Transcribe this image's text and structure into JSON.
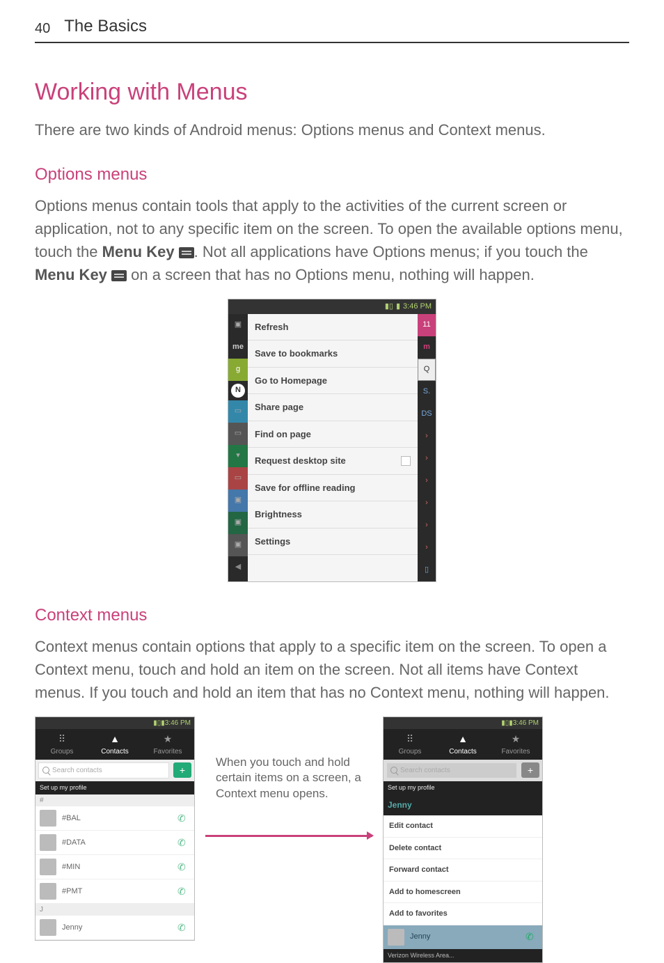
{
  "page": {
    "number": "40",
    "breadcrumb": "The Basics"
  },
  "h1": "Working with Menus",
  "intro": "There are two kinds of Android menus: Options menus and Context menus.",
  "options": {
    "heading": "Options menus",
    "p_a": "Options menus contain tools that apply to the activities of the current screen or application, not to any specific item on the screen. To open the available options menu, touch the ",
    "menu_key_1": "Menu Key ",
    "p_b": ". Not all applications have Options menus; if you touch the ",
    "menu_key_2": "Menu Key ",
    "p_c": " on a screen that has no Options menu, nothing will happen."
  },
  "options_shot": {
    "time": "3:46 PM",
    "items": [
      "Refresh",
      "Save to bookmarks",
      "Go to Homepage",
      "Share page",
      "Find on page",
      "Request desktop site",
      "Save for offline reading",
      "Brightness",
      "Settings"
    ]
  },
  "context": {
    "heading": "Context menus",
    "p": "Context menus contain options that apply to a specific item on the screen. To open a Context menu, touch and hold an item on the screen. Not all items have Context menus. If you touch and hold an item that has no Context menu, nothing will happen."
  },
  "contacts_shot": {
    "time": "3:46 PM",
    "tabs": {
      "groups": "Groups",
      "contacts": "Contacts",
      "favorites": "Favorites"
    },
    "search_placeholder": "Search contacts",
    "setup": "Set up my profile",
    "idx0": "#",
    "list": [
      "#BAL",
      "#DATA",
      "#MIN",
      "#PMT"
    ],
    "idxJ": "J",
    "jenny": "Jenny"
  },
  "annotation": "When you touch and hold certain items on a screen, a Context menu opens.",
  "ctx_shot": {
    "time": "3:46 PM",
    "header": "Jenny",
    "items": [
      "Edit contact",
      "Delete contact",
      "Forward contact",
      "Add to homescreen",
      "Add to favorites"
    ],
    "caller": "Jenny",
    "footer": "Verizon Wireless Area..."
  }
}
